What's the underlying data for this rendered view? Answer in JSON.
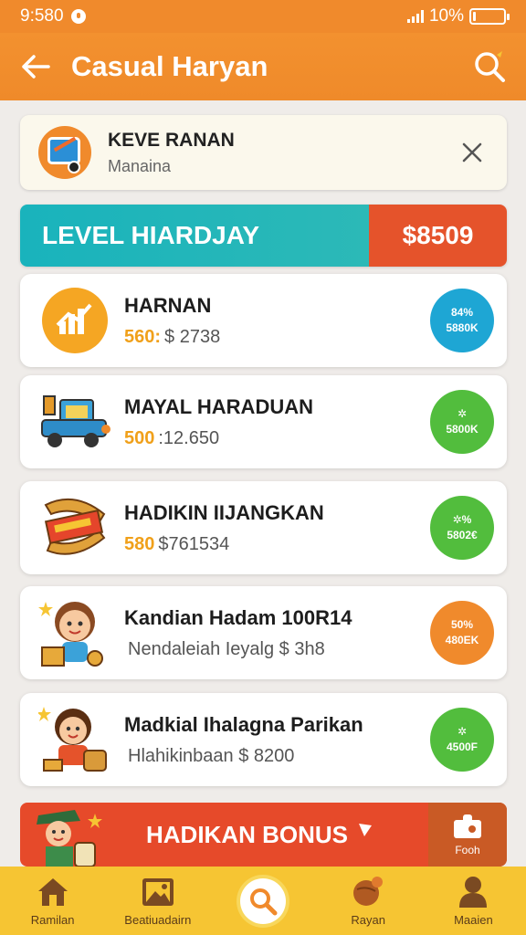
{
  "status_bar": {
    "time": "9:580",
    "battery": "10%",
    "battery_level": 0.1
  },
  "app_bar": {
    "title": "Casual Haryan"
  },
  "notice": {
    "title": "KEVE RANAN",
    "subtitle": "Manaina"
  },
  "level": {
    "label": "LEVEL HIARDJAY",
    "amount": "$8509"
  },
  "cards": [
    {
      "title": "HARNAN",
      "highlight": "560:",
      "value": "$ 2738",
      "badge_line1": "84%",
      "badge_line2": "5880K",
      "badge_color": "#1ea6d4"
    },
    {
      "title": "MAYAL HARADUAN",
      "highlight": "500",
      "value": ":12.650",
      "badge_line1": "✲",
      "badge_line2": "5800K",
      "badge_color": "#52bd3d"
    },
    {
      "title": "HADIKIN IIJANGKAN",
      "highlight": "580",
      "value": "$761534",
      "badge_line1": "✲%",
      "badge_line2": "5802€",
      "badge_color": "#52bd3d"
    },
    {
      "title": "Kandian Hadam 100R14",
      "highlight": "",
      "value": "Nendaleiah Ieyalg $ 3h8",
      "badge_line1": "50%",
      "badge_line2": "480EK",
      "badge_color": "#f08a2c"
    },
    {
      "title": "Madkial Ihalagna Parikan",
      "highlight": "",
      "value": "Hlahikinbaan $ 8200",
      "badge_line1": "✲",
      "badge_line2": "4500F",
      "badge_color": "#52bd3d"
    }
  ],
  "bonus": {
    "label": "HADIKAN BONUS",
    "side_label": "Fooh"
  },
  "bottom_nav": [
    {
      "label": "Ramilan",
      "icon": "home-icon"
    },
    {
      "label": "Beatiuadairn",
      "icon": "image-icon"
    },
    {
      "label": "",
      "icon": "search-icon"
    },
    {
      "label": "Rayan",
      "icon": "ball-icon"
    },
    {
      "label": "Maaien",
      "icon": "person-icon"
    }
  ],
  "colors": {
    "primary": "#f08a2c",
    "teal": "#19b3bc",
    "red": "#e5532b",
    "nav": "#f6c533"
  }
}
